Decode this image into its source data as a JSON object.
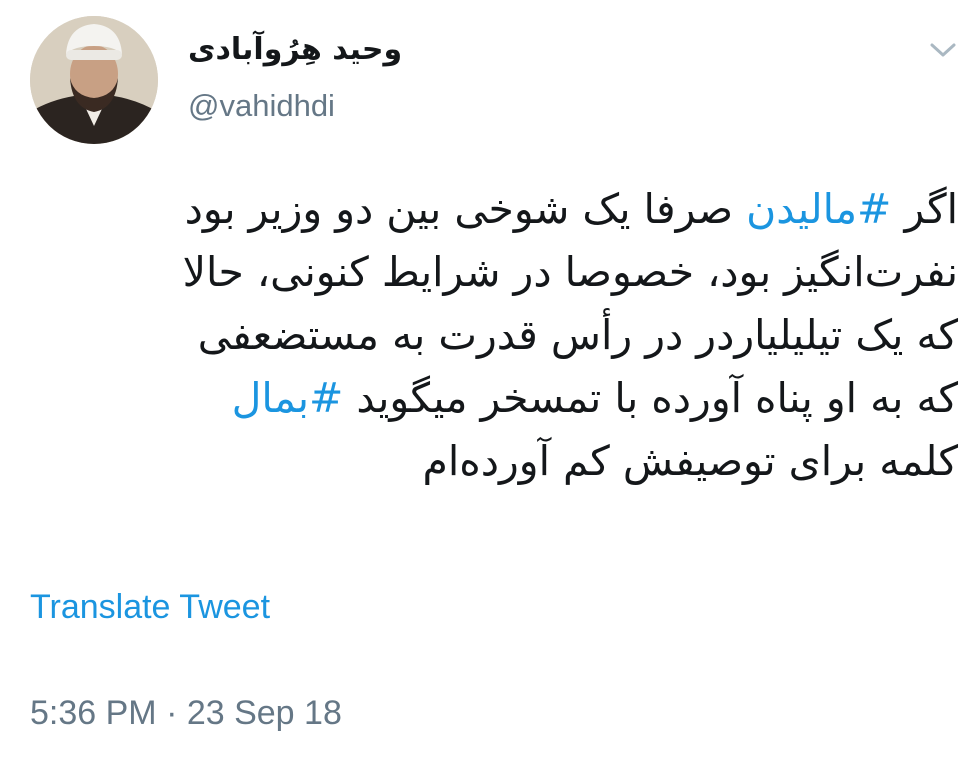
{
  "author": {
    "display_name": "وحید هِرُوآبادی",
    "handle": "@vahidhdi"
  },
  "icons": {
    "caret": "chevron-down-icon"
  },
  "tweet": {
    "lines": [
      {
        "before": "اگر ",
        "hashtag": "#مالیدن",
        "after": " صرفا یک شوخی بین دو وزیر بود"
      },
      {
        "text": "نفرت‌انگیز بود، خصوصا در شرایط کنونی، حالا"
      },
      {
        "text": "که یک تیلیلیاردر در رأس قدرت به مستضعفی"
      },
      {
        "before": "که به او پناه آورده با تمسخر میگوید ",
        "hashtag": "#بمال"
      },
      {
        "text": "کلمه برای توصیفش کم آورده‌ام"
      }
    ]
  },
  "translate_label": "Translate Tweet",
  "timestamp": "5:36 PM · 23 Sep 18",
  "colors": {
    "link": "#1b95e0",
    "secondary_text": "#657786",
    "primary_text": "#14171a"
  }
}
